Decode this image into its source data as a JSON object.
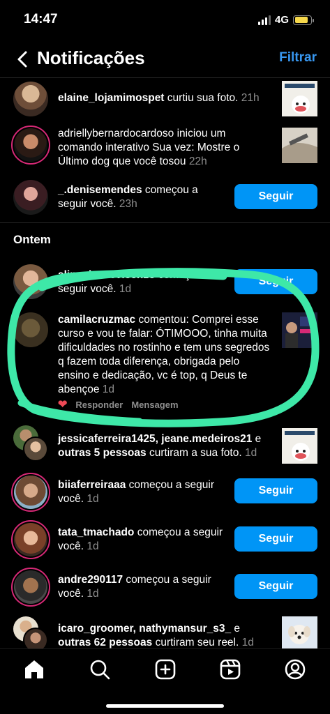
{
  "status": {
    "time": "14:47",
    "network": "4G",
    "battery_level": 0.85,
    "battery_color": "#f7d94c"
  },
  "header": {
    "title": "Notificações",
    "filter_label": "Filtrar",
    "accent": "#3897f0"
  },
  "notifications_today": [
    {
      "user": "elaine_lojamimospet",
      "action": " curtiu sua foto.",
      "time": "21h",
      "thumb": true
    },
    {
      "user": "",
      "action": "adriellybernardocardoso iniciou um comando interativo Sua vez: Mostre o Último dog que você tosou",
      "time": "22h",
      "thumb": true
    },
    {
      "user": "_.denisemendes",
      "action": " começou a seguir você.",
      "time": "23h",
      "button": "Seguir"
    }
  ],
  "section_yesterday": "Ontem",
  "notifications_yesterday": [
    {
      "user": "aline_isaacvicenzo",
      "action": " começou a seguir você.",
      "time": "1d",
      "button": "Seguir"
    },
    {
      "user": "camilacruzmac",
      "action": " comentou: Comprei esse curso e vou te falar: ÓTIMOOO, tinha muita dificuldades no rostinho e tem uns segredos q fazem toda diferença, obrigada pelo ensino e dedicação, vc é top, q Deus te abençoe",
      "time": "1d",
      "thumb": true,
      "reply_label": "Responder",
      "message_label": "Mensagem"
    },
    {
      "user": "jessicaferreira1425, jeane.medeiros21",
      "connector": " e ",
      "user2": "outras 5 pessoas",
      "action": " curtiram a sua foto.",
      "time": "1d",
      "thumb": true
    },
    {
      "user": "biiaferreiraaa",
      "action": " começou a seguir você.",
      "time": "1d",
      "button": "Seguir"
    },
    {
      "user": "tata_tmachado",
      "action": " começou a seguir você.",
      "time": "1d",
      "button": "Seguir"
    },
    {
      "user": "andre290117",
      "action": " começou a seguir você.",
      "time": "1d",
      "button": "Seguir"
    },
    {
      "user": "icaro_groomer, nathymansur_s3_",
      "connector": " e ",
      "user2": "outras 62 pessoas",
      "action": " curtiram seu reel.",
      "time": "1d",
      "thumb": true
    }
  ],
  "tabs": [
    "home-icon",
    "search-icon",
    "create-icon",
    "reels-icon",
    "profile-icon"
  ],
  "colors": {
    "follow_button": "#0095f6",
    "story_ring": "#d62976",
    "highlight_scribble": "#3ee8a8",
    "heart": "#ed4956"
  }
}
